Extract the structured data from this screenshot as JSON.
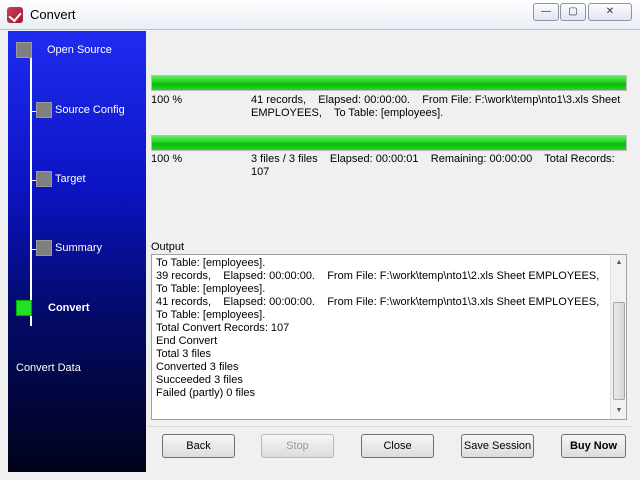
{
  "window": {
    "title": "Convert",
    "controls": {
      "minimize": "—",
      "maximize": "▢",
      "close": "✕"
    }
  },
  "sidebar": {
    "steps": [
      {
        "label": "Open Source",
        "state": "done"
      },
      {
        "label": "Source Config",
        "state": "done"
      },
      {
        "label": "Target",
        "state": "done"
      },
      {
        "label": "Summary",
        "state": "done"
      },
      {
        "label": "Convert",
        "state": "active"
      }
    ],
    "footer": "Convert Data",
    "colors": {
      "active": "#22e022",
      "inactive": "#808080"
    }
  },
  "progress": {
    "file": {
      "fraction": 1.0,
      "percent": "100 %",
      "info": "41 records,    Elapsed: 00:00:00.    From File: F:\\work\\temp\\nto1\\3.xls Sheet EMPLOYEES,    To Table: [employees]."
    },
    "total": {
      "fraction": 1.0,
      "percent": "100 %",
      "info": "3 files / 3 files    Elapsed: 00:00:01    Remaining: 00:00:00    Total Records: 107"
    }
  },
  "output": {
    "label": "Output",
    "lines": [
      "To Table: [employees].",
      "39 records,    Elapsed: 00:00:00.    From File: F:\\work\\temp\\nto1\\2.xls Sheet EMPLOYEES,",
      "To Table: [employees].",
      "41 records,    Elapsed: 00:00:00.    From File: F:\\work\\temp\\nto1\\3.xls Sheet EMPLOYEES,",
      "To Table: [employees].",
      "Total Convert Records: 107",
      "End Convert",
      "Total 3 files",
      "Converted 3 files",
      "Succeeded 3 files",
      "Failed (partly) 0 files"
    ]
  },
  "buttons": {
    "back": "Back",
    "stop": "Stop",
    "close": "Close",
    "save_session": "Save Session",
    "buy_now": "Buy Now"
  }
}
